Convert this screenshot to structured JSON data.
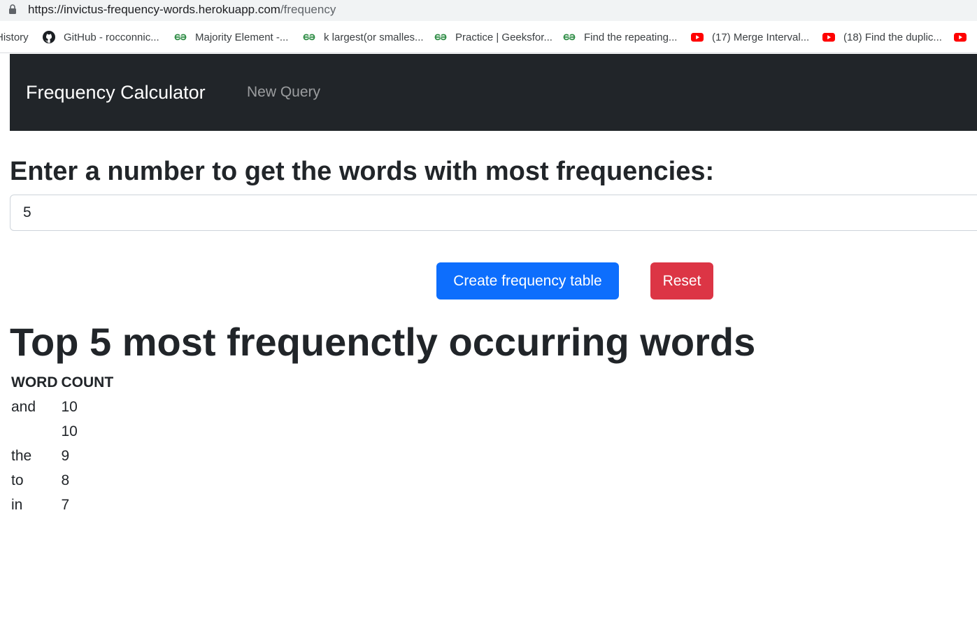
{
  "browser": {
    "url_host": "https://invictus-frequency-words.herokuapp.com",
    "url_path": "/frequency",
    "bookmarks": [
      {
        "label": "History",
        "icon": "none"
      },
      {
        "label": "GitHub - rocconnic...",
        "icon": "github-icon"
      },
      {
        "label": "Majority Element -...",
        "icon": "geeksforgeeks-icon"
      },
      {
        "label": "k largest(or smalles...",
        "icon": "geeksforgeeks-icon"
      },
      {
        "label": "Practice | Geeksfor...",
        "icon": "geeksforgeeks-icon"
      },
      {
        "label": "Find the repeating...",
        "icon": "geeksforgeeks-icon"
      },
      {
        "label": "(17) Merge Interval...",
        "icon": "youtube-icon"
      },
      {
        "label": "(18) Find the duplic...",
        "icon": "youtube-icon"
      }
    ]
  },
  "navbar": {
    "brand": "Frequency Calculator",
    "link": "New Query"
  },
  "form": {
    "prompt": "Enter a number to get the words with most frequencies:",
    "value": "5",
    "submit_label": "Create frequency table",
    "reset_label": "Reset"
  },
  "results": {
    "title": "Top 5 most frequenctly occurring words",
    "headers": [
      "WORD",
      "COUNT"
    ],
    "rows": [
      {
        "word": "and",
        "count": "10"
      },
      {
        "word": "",
        "count": "10"
      },
      {
        "word": "the",
        "count": "9"
      },
      {
        "word": "to",
        "count": "8"
      },
      {
        "word": "in",
        "count": "7"
      }
    ]
  },
  "colors": {
    "navbar": "#212529",
    "primary": "#0d6efd",
    "danger": "#dc3545",
    "geeksforgeeks": "#2f8d46",
    "youtube": "#ff0000"
  }
}
